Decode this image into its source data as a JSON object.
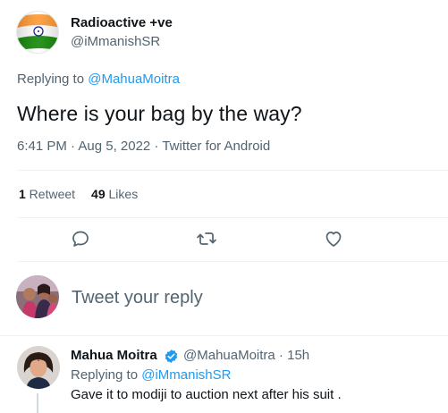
{
  "tweet": {
    "author_name": "Radioactive +ve",
    "author_handle": "@iMmanishSR",
    "replying_prefix": "Replying to ",
    "replying_to": "@MahuaMoitra",
    "text": "Where is your bag by the way?",
    "meta": "6:41 PM · Aug 5, 2022 · Twitter for Android",
    "retweets_count": "1",
    "retweets_label": " Retweet",
    "likes_count": "49",
    "likes_label": " Likes"
  },
  "actions": [
    {
      "icon": "reply-icon"
    },
    {
      "icon": "retweet-icon"
    },
    {
      "icon": "like-icon"
    }
  ],
  "reply_box": {
    "placeholder": "Tweet your reply"
  },
  "reply": {
    "author_name": "Mahua Moitra",
    "author_handle": "@MahuaMoitra · 15h",
    "replying_prefix": "Replying to ",
    "replying_to": "@iMmanishSR",
    "text": "Gave it to modiji to auction next after his suit ."
  },
  "colors": {
    "link": "#1d9bf0",
    "secondary": "#536471",
    "primary_text": "#0f1419",
    "verified": "#1d9bf0",
    "flag_saffron": "#ff9933",
    "flag_green": "#138808",
    "flag_chakra": "#000080"
  }
}
